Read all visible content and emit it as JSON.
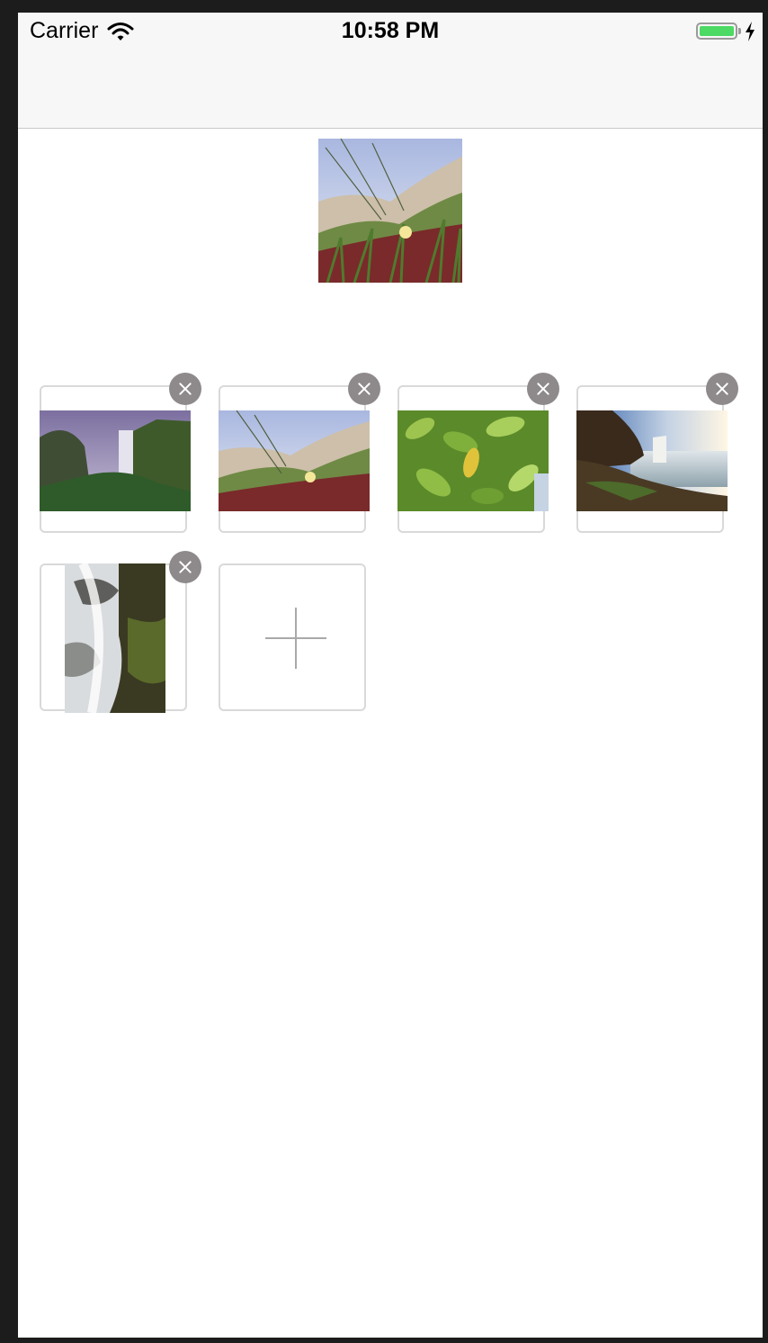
{
  "status_bar": {
    "carrier": "Carrier",
    "time": "10:58 PM",
    "battery_level": 1.0,
    "charging": true,
    "icons": [
      "wifi-icon",
      "battery-icon",
      "charging-bolt-icon"
    ]
  },
  "preview": {
    "image": "meadow-flower-photo"
  },
  "photos": [
    {
      "image": "waterfall-cliff-photo"
    },
    {
      "image": "meadow-flower-photo"
    },
    {
      "image": "green-leaves-photo"
    },
    {
      "image": "sea-waterfall-photo"
    },
    {
      "image": "cascade-rocks-photo"
    }
  ],
  "add_button": {
    "icon": "plus-icon"
  },
  "colors": {
    "delete_badge": "#8e8a8c",
    "cell_border": "#d9d9d9",
    "battery": "#4cd964",
    "navbar": "#f7f7f7"
  }
}
